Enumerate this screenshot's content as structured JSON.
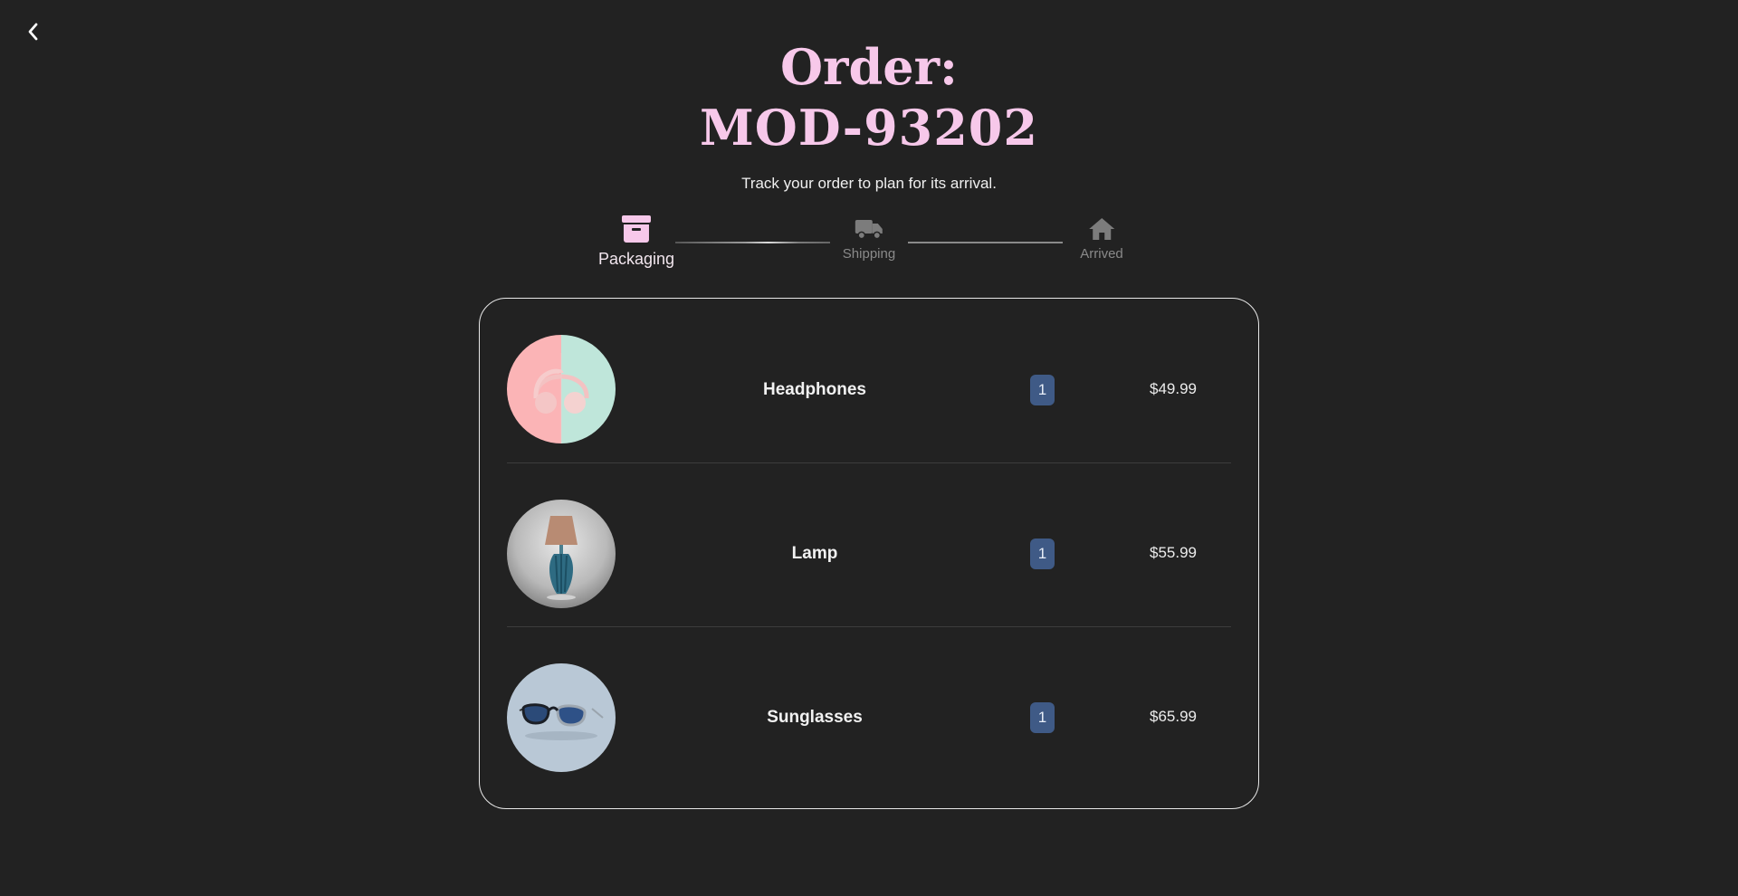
{
  "header": {
    "back_icon": "chevron-left-icon",
    "title_line1": "Order:",
    "title_line2": "MOD-93202",
    "subtitle": "Track your order to plan for its arrival."
  },
  "tracker": {
    "active_step": "Packaging",
    "steps": [
      {
        "label": "Packaging",
        "icon": "archive-box-icon",
        "active": true
      },
      {
        "label": "Shipping",
        "icon": "truck-icon",
        "active": false
      },
      {
        "label": "Arrived",
        "icon": "home-icon",
        "active": false
      }
    ]
  },
  "order": {
    "items": [
      {
        "name": "Headphones",
        "quantity": "1",
        "price": "$49.99",
        "image": "headphones-image"
      },
      {
        "name": "Lamp",
        "quantity": "1",
        "price": "$55.99",
        "image": "lamp-image"
      },
      {
        "name": "Sunglasses",
        "quantity": "1",
        "price": "$65.99",
        "image": "sunglasses-image"
      }
    ]
  },
  "colors": {
    "background": "#222222",
    "accent_pink": "#f7c8ea",
    "badge_blue": "#3f5a86",
    "inactive_gray": "#8a8a8a"
  }
}
